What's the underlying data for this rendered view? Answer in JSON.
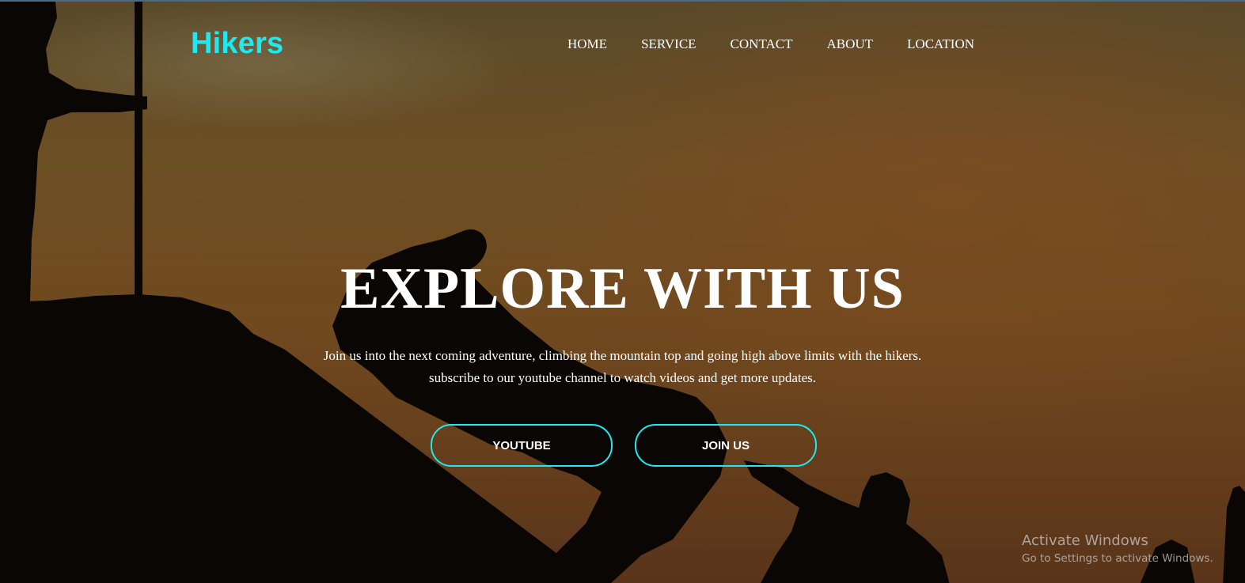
{
  "brand": {
    "name": "Hikers",
    "color": "#1fe9f0"
  },
  "nav": {
    "items": [
      {
        "label": "HOME"
      },
      {
        "label": "SERVICE"
      },
      {
        "label": "CONTACT"
      },
      {
        "label": "ABOUT"
      },
      {
        "label": "LOCATION"
      }
    ]
  },
  "hero": {
    "title": "EXPLORE WITH US",
    "line1": "Join us into the next coming adventure, climbing the mountain top and going high above limits with the hikers.",
    "line2": "subscribe to our youtube channel to watch videos and get more updates.",
    "buttons": {
      "youtube": "YOUTUBE",
      "join": "JOIN US"
    },
    "background_image": "silhouettes of hikers helping each other climb a mountain at sunset"
  },
  "watermark": {
    "title": "Activate Windows",
    "subtitle": "Go to Settings to activate Windows."
  }
}
